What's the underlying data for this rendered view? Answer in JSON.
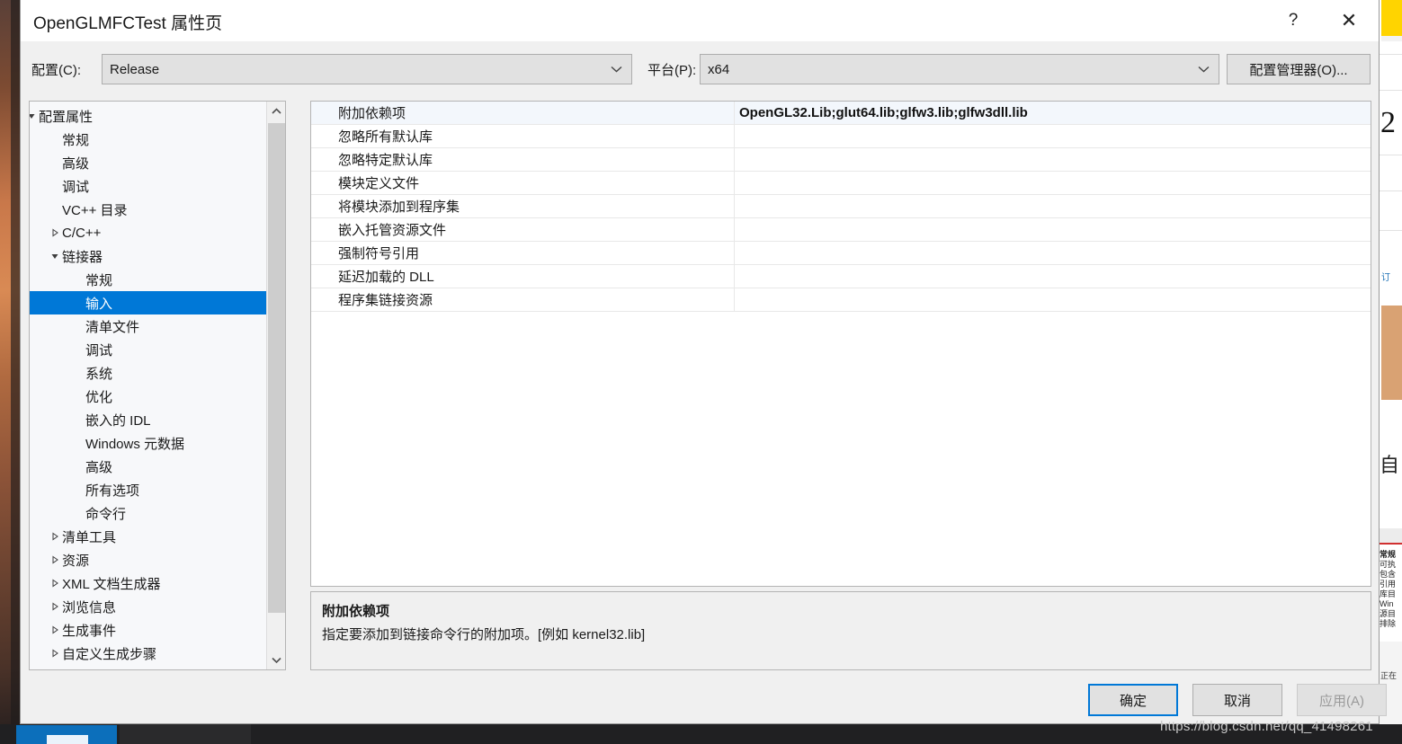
{
  "window": {
    "title": "OpenGLMFCTest 属性页",
    "help_icon": "?",
    "close_icon": "✕"
  },
  "configbar": {
    "config_label": "配置(C):",
    "config_value": "Release",
    "platform_label": "平台(P):",
    "platform_value": "x64",
    "config_manager_button": "配置管理器(O)..."
  },
  "tree": {
    "items": [
      {
        "label": "配置属性",
        "indent": 0,
        "arrow": "▲",
        "selected": false
      },
      {
        "label": "常规",
        "indent": 1,
        "arrow": "",
        "selected": false
      },
      {
        "label": "高级",
        "indent": 1,
        "arrow": "",
        "selected": false
      },
      {
        "label": "调试",
        "indent": 1,
        "arrow": "",
        "selected": false
      },
      {
        "label": "VC++ 目录",
        "indent": 1,
        "arrow": "",
        "selected": false
      },
      {
        "label": "C/C++",
        "indent": 1,
        "arrow": "▶",
        "selected": false
      },
      {
        "label": "链接器",
        "indent": 1,
        "arrow": "▲",
        "selected": false
      },
      {
        "label": "常规",
        "indent": 2,
        "arrow": "",
        "selected": false
      },
      {
        "label": "输入",
        "indent": 2,
        "arrow": "",
        "selected": true
      },
      {
        "label": "清单文件",
        "indent": 2,
        "arrow": "",
        "selected": false
      },
      {
        "label": "调试",
        "indent": 2,
        "arrow": "",
        "selected": false
      },
      {
        "label": "系统",
        "indent": 2,
        "arrow": "",
        "selected": false
      },
      {
        "label": "优化",
        "indent": 2,
        "arrow": "",
        "selected": false
      },
      {
        "label": "嵌入的 IDL",
        "indent": 2,
        "arrow": "",
        "selected": false
      },
      {
        "label": "Windows 元数据",
        "indent": 2,
        "arrow": "",
        "selected": false
      },
      {
        "label": "高级",
        "indent": 2,
        "arrow": "",
        "selected": false
      },
      {
        "label": "所有选项",
        "indent": 2,
        "arrow": "",
        "selected": false
      },
      {
        "label": "命令行",
        "indent": 2,
        "arrow": "",
        "selected": false
      },
      {
        "label": "清单工具",
        "indent": 1,
        "arrow": "▶",
        "selected": false
      },
      {
        "label": "资源",
        "indent": 1,
        "arrow": "▶",
        "selected": false
      },
      {
        "label": "XML 文档生成器",
        "indent": 1,
        "arrow": "▶",
        "selected": false
      },
      {
        "label": "浏览信息",
        "indent": 1,
        "arrow": "▶",
        "selected": false
      },
      {
        "label": "生成事件",
        "indent": 1,
        "arrow": "▶",
        "selected": false
      },
      {
        "label": "自定义生成步骤",
        "indent": 1,
        "arrow": "▶",
        "selected": false
      }
    ],
    "scroll_up_icon": "⌃",
    "scroll_down_icon": "⌄"
  },
  "grid": {
    "rows": [
      {
        "name": "附加依赖项",
        "value": "OpenGL32.Lib;glut64.lib;glfw3.lib;glfw3dll.lib",
        "selected": true
      },
      {
        "name": "忽略所有默认库",
        "value": "",
        "selected": false
      },
      {
        "name": "忽略特定默认库",
        "value": "",
        "selected": false
      },
      {
        "name": "模块定义文件",
        "value": "",
        "selected": false
      },
      {
        "name": "将模块添加到程序集",
        "value": "",
        "selected": false
      },
      {
        "name": "嵌入托管资源文件",
        "value": "",
        "selected": false
      },
      {
        "name": "强制符号引用",
        "value": "",
        "selected": false
      },
      {
        "name": "延迟加载的 DLL",
        "value": "",
        "selected": false
      },
      {
        "name": "程序集链接资源",
        "value": "",
        "selected": false
      }
    ]
  },
  "description": {
    "title": "附加依赖项",
    "body": "指定要添加到链接命令行的附加项。[例如 kernel32.lib]"
  },
  "footer": {
    "ok": "确定",
    "cancel": "取消",
    "apply": "应用(A)"
  },
  "watermark": {
    "text": "https://blog.csdn.net/qq_41498261"
  },
  "background": {
    "big_digit": "2",
    "side_glyph": "自",
    "tiny_lines": [
      "常规",
      "可执",
      "包含",
      "引用",
      "库目",
      "Win",
      "源目",
      "排除"
    ],
    "bottom_label": "正在"
  },
  "colors": {
    "accent": "#0078d7",
    "dialog_bg": "#f0f0f0",
    "grid_selection": "#f3f7fc",
    "tree_bg": "#f7f8fa"
  }
}
